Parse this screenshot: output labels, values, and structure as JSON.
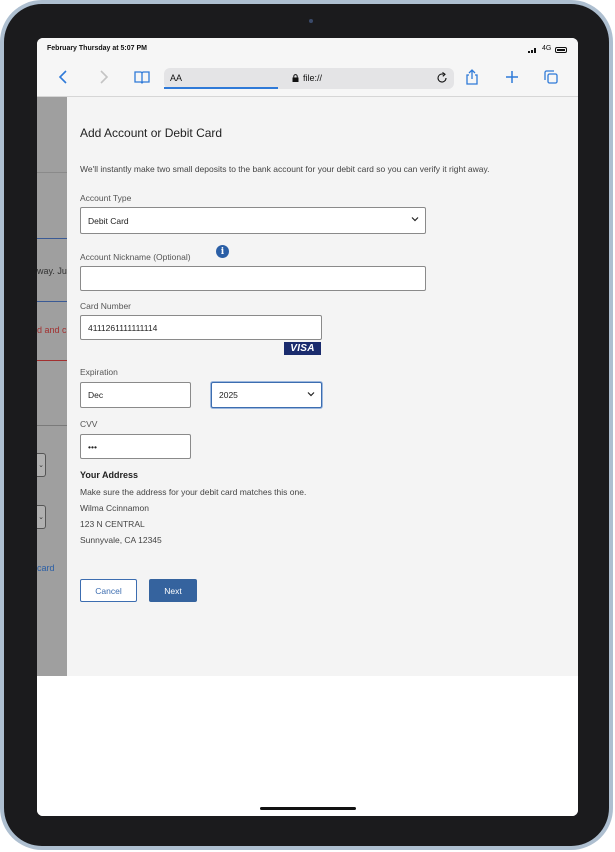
{
  "status": {
    "time": "February Thursday at 5:07 PM",
    "network": "4G"
  },
  "toolbar": {
    "text_size": "AA",
    "url": "file://",
    "icons": [
      "chevron-left-icon",
      "chevron-right-icon",
      "book-icon",
      "lock-icon",
      "reload-icon",
      "share-icon",
      "plus-icon",
      "tabs-icon"
    ]
  },
  "background_page": {
    "text_fragment": "way. Ju",
    "error_fragment": "d and c",
    "link_fragment": "card"
  },
  "modal": {
    "title": "Add Account or Debit Card",
    "description": "We'll instantly make two small deposits to the bank account for your debit card so you can verify it right away.",
    "account_type_label": "Account Type",
    "account_type_value": "Debit Card",
    "nickname_label": "Account Nickname (Optional)",
    "nickname_value": "",
    "card_number_label": "Card Number",
    "card_number_value": "4111261111111114",
    "card_brand": "VISA",
    "expiration_label": "Expiration",
    "exp_month_value": "Dec",
    "exp_year_value": "2025",
    "cvv_label": "CVV",
    "cvv_value": "•••",
    "address_heading": "Your Address",
    "address_note": "Make sure the address for your debit card matches this one.",
    "address_name": "Wilma Ccinnamon",
    "address_line1": "123 N CENTRAL",
    "address_line2": "Sunnyvale, CA 12345",
    "cancel_label": "Cancel",
    "next_label": "Next"
  },
  "colors": {
    "primary": "#35639e",
    "link": "#2f7ad8",
    "error": "#b03a3a",
    "overlay": "#9f9f9f"
  }
}
